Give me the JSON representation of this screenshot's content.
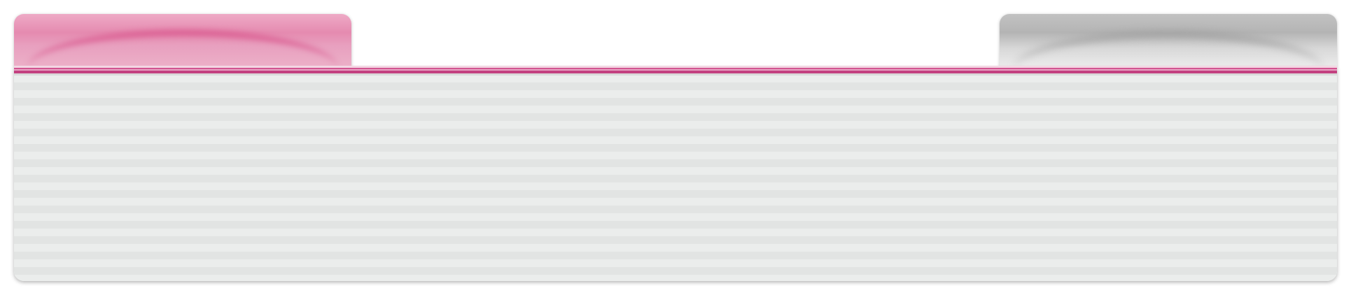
{
  "tabs": [
    {
      "label": "",
      "state": "active"
    },
    {
      "label": "",
      "state": "inactive"
    }
  ],
  "panel": {
    "content": ""
  },
  "colors": {
    "accent": "#c3407f",
    "active_tab": "#e58bb0",
    "inactive_tab": "#b4b4b4",
    "panel_stripe_dark": "#e2e4e3",
    "panel_stripe_light": "#ebedec"
  }
}
